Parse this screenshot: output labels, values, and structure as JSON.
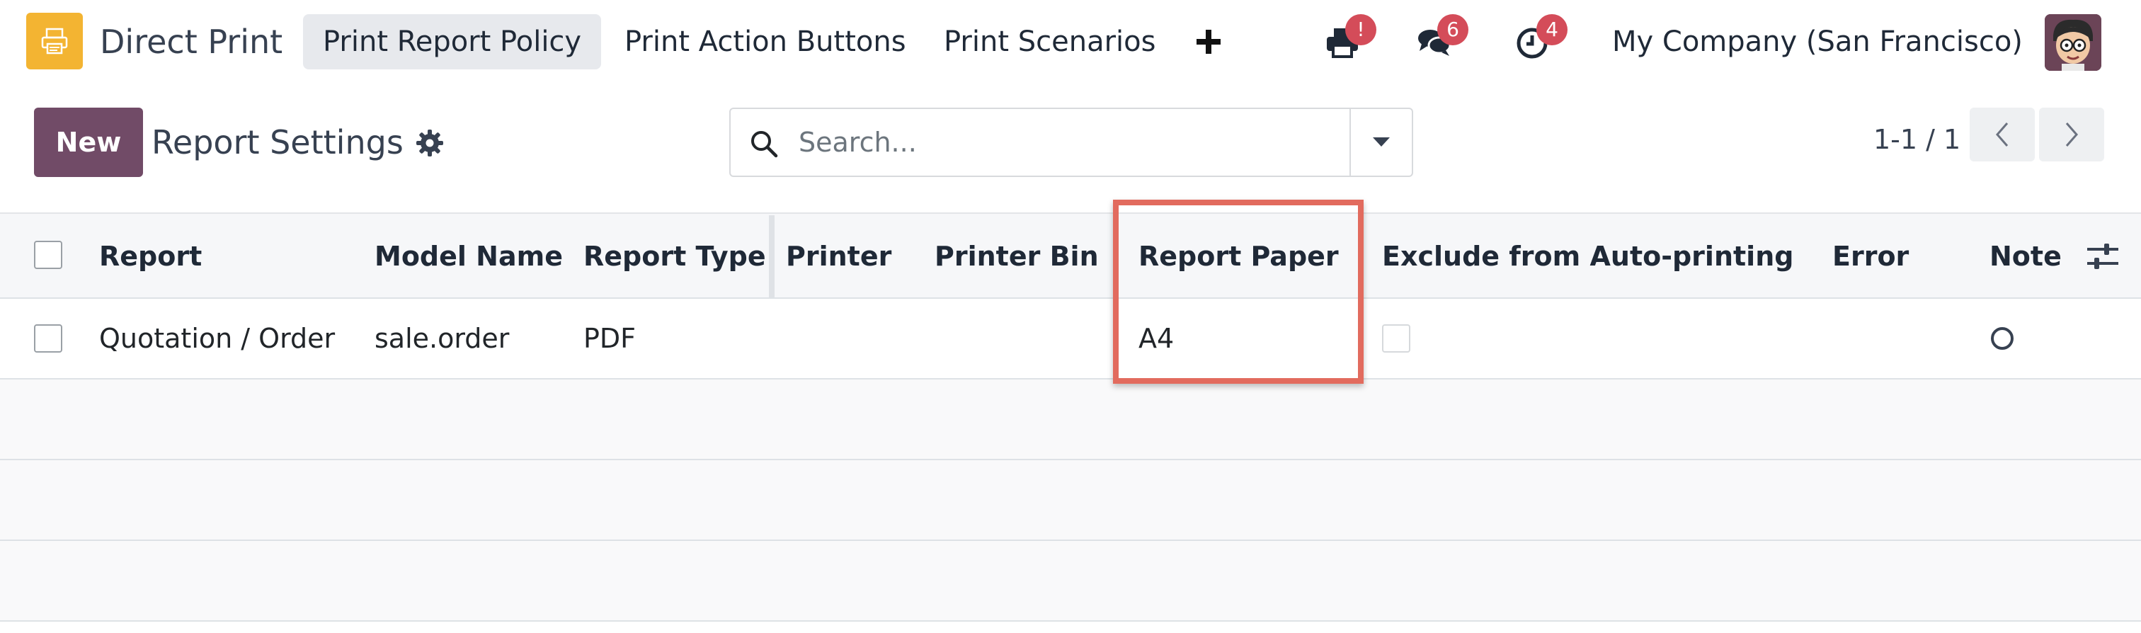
{
  "navbar": {
    "app_name": "Direct Print",
    "menu": [
      {
        "label": "Print Report Policy",
        "active": true
      },
      {
        "label": "Print Action Buttons",
        "active": false
      },
      {
        "label": "Print Scenarios",
        "active": false
      }
    ],
    "add_icon": "plus-icon",
    "systray": {
      "printer_badge": "!",
      "messages_badge": "6",
      "activities_badge": "4"
    },
    "company": "My Company (San Francisco)",
    "badge_color": "#d44c59"
  },
  "control_panel": {
    "new_label": "New",
    "title": "Report Settings",
    "search_placeholder": "Search...",
    "pager": "1-1 / 1",
    "brand_color": "#714b67"
  },
  "table": {
    "columns": [
      "Report",
      "Model Name",
      "Report Type",
      "Printer",
      "Printer Bin",
      "Report Paper",
      "Exclude from Auto-printing",
      "Error",
      "Note"
    ],
    "rows": [
      {
        "report": "Quotation / Order",
        "model_name": "sale.order",
        "report_type": "PDF",
        "printer": "",
        "printer_bin": "",
        "report_paper": "A4",
        "exclude": false,
        "error": "",
        "note": "circle-icon"
      }
    ],
    "highlight_color": "#e26b5e"
  }
}
